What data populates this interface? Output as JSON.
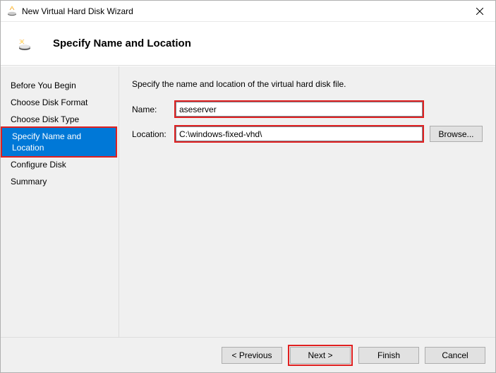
{
  "window": {
    "title": "New Virtual Hard Disk Wizard"
  },
  "header": {
    "title": "Specify Name and Location"
  },
  "sidebar": {
    "items": [
      {
        "label": "Before You Begin"
      },
      {
        "label": "Choose Disk Format"
      },
      {
        "label": "Choose Disk Type"
      },
      {
        "label": "Specify Name and Location"
      },
      {
        "label": "Configure Disk"
      },
      {
        "label": "Summary"
      }
    ],
    "active_index": 3
  },
  "main": {
    "instruction": "Specify the name and location of the virtual hard disk file.",
    "name_label": "Name:",
    "name_value": "aseserver",
    "location_label": "Location:",
    "location_value": "C:\\windows-fixed-vhd\\",
    "browse_label": "Browse..."
  },
  "footer": {
    "previous": "< Previous",
    "next": "Next >",
    "finish": "Finish",
    "cancel": "Cancel"
  }
}
